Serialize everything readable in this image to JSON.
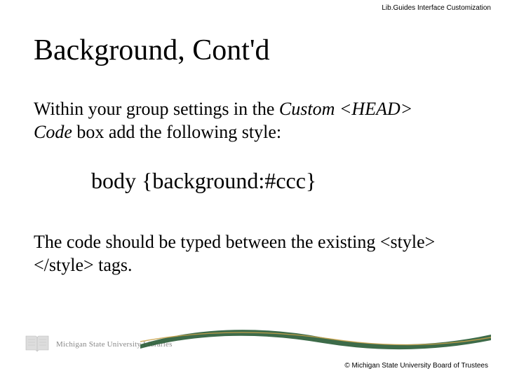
{
  "header": {
    "label": "Lib.Guides Interface Customization"
  },
  "slide": {
    "title": "Background, Cont'd",
    "p1a": "Within your group settings in the ",
    "p1b": "Custom <HEAD> Code",
    "p1c": " box add the following style:",
    "code": "body {background:#ccc}",
    "p2": "The code should be typed between the existing <style></style> tags."
  },
  "footer": {
    "logo_text": "Michigan State University Libraries",
    "copyright": "© Michigan State University Board of Trustees"
  }
}
